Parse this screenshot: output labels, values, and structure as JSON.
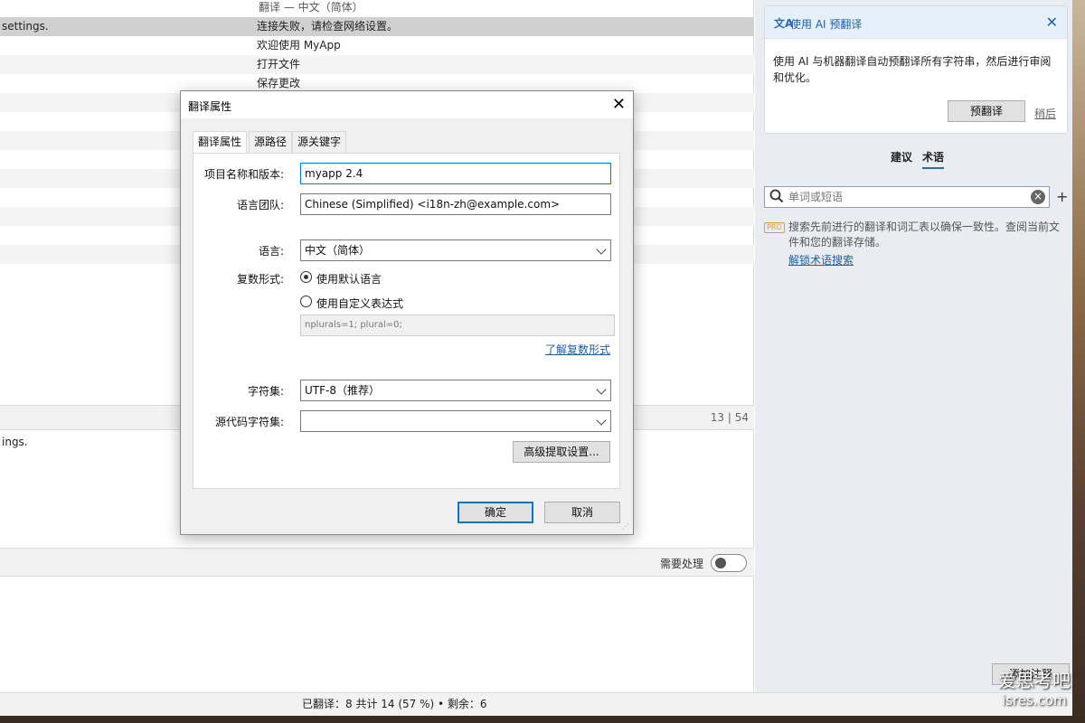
{
  "list": {
    "header": "翻译 — 中文（简体）",
    "rows": [
      {
        "source": "settings.",
        "target": "连接失败，请检查网络设置。"
      },
      {
        "source": "",
        "target": "欢迎使用 MyApp"
      },
      {
        "source": "",
        "target": "打开文件"
      },
      {
        "source": "",
        "target": "保存更改"
      }
    ],
    "counter": "13 | 54"
  },
  "source_editor": {
    "text": "ings."
  },
  "translation_bar": {
    "needs_work_label": "需要处理"
  },
  "status_bar": {
    "text": "已翻译：8 共计 14 (57 %)  •  剩余：6"
  },
  "side_panel": {
    "ai_card": {
      "icon": "文A",
      "title": "使用 AI 预翻译",
      "close": "✕",
      "description": "使用 AI 与机器翻译自动预翻译所有字符串，然后进行审阅和优化。",
      "pretranslate_button": "预翻译",
      "later_link": "稍后"
    },
    "tabs": {
      "suggestions": "建议",
      "terminology": "术语"
    },
    "search": {
      "placeholder": "单词或短语",
      "clear": "×",
      "add": "+"
    },
    "pro": {
      "badge": "PRO",
      "text": "搜索先前进行的翻译和词汇表以确保一致性。查阅当前文件和您的翻译存储。",
      "link": "解锁术语搜索"
    },
    "add_note_button": "添加注释"
  },
  "watermark": {
    "line1": "爱思考吧",
    "line2": "isres.com"
  },
  "dialog": {
    "title": "翻译属性",
    "close": "✕",
    "tabs": [
      "翻译属性",
      "源路径",
      "源关键字"
    ],
    "fields": {
      "project_label": "项目名称和版本:",
      "project_value": "myapp 2.4",
      "team_label": "语言团队:",
      "team_value": "Chinese (Simplified) <i18n-zh@example.com>",
      "language_label": "语言:",
      "language_value": "中文（简体）",
      "plural_label": "复数形式:",
      "plural_default": "使用默认语言",
      "plural_custom": "使用自定义表达式",
      "plural_expression": "nplurals=1; plural=0;",
      "plural_link": "了解复数形式",
      "charset_label": "字符集:",
      "charset_value": "UTF-8（推荐）",
      "source_charset_label": "源代码字符集:",
      "source_charset_value": "",
      "advanced_button": "高级提取设置..."
    },
    "ok": "确定",
    "cancel": "取消"
  }
}
